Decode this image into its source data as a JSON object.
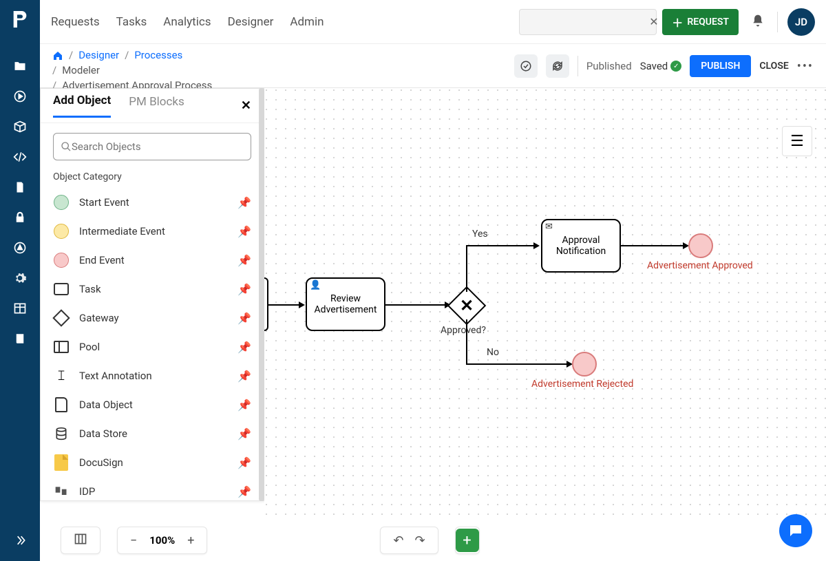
{
  "topnav": {
    "requests": "Requests",
    "tasks": "Tasks",
    "analytics": "Analytics",
    "designer": "Designer",
    "admin": "Admin",
    "search_placeholder": "",
    "request_btn": "REQUEST",
    "avatar": "JD"
  },
  "breadcrumb": {
    "designer": "Designer",
    "processes": "Processes",
    "modeler": "Modeler",
    "process": "Advertisement Approval Process"
  },
  "topright": {
    "published": "Published",
    "saved": "Saved",
    "publish_btn": "PUBLISH",
    "close_btn": "CLOSE"
  },
  "panel": {
    "tab_add": "Add Object",
    "tab_pm": "PM Blocks",
    "search_placeholder": "Search Objects",
    "category": "Object Category",
    "items": [
      "Start Event",
      "Intermediate Event",
      "End Event",
      "Task",
      "Gateway",
      "Pool",
      "Text Annotation",
      "Data Object",
      "Data Store",
      "DocuSign",
      "IDP"
    ]
  },
  "canvas": {
    "task_review": "Review Advertisement",
    "gateway_label": "Approved?",
    "edge_yes": "Yes",
    "edge_no": "No",
    "task_notify": "Approval Notification",
    "end_approved": "Advertisement Approved",
    "end_rejected": "Advertisement Rejected"
  },
  "zoom": "100%"
}
